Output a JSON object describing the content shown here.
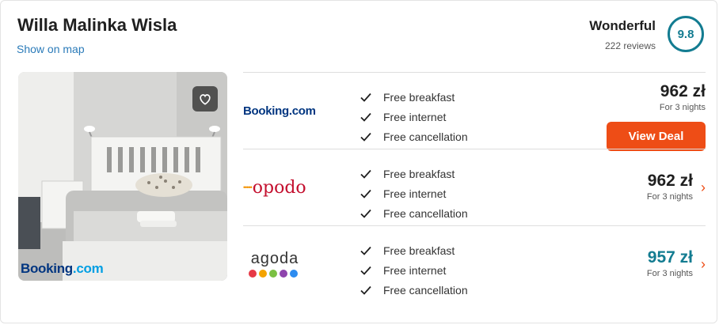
{
  "hotel": {
    "name": "Willa Malinka Wisla",
    "map_link": "Show on map",
    "rating_word": "Wonderful",
    "reviews": "222 reviews",
    "score": "9.8"
  },
  "photo": {
    "logo_booking": "Booking",
    "logo_dotcom": ".com"
  },
  "offers": [
    {
      "provider": "Booking.com",
      "features": [
        "Free breakfast",
        "Free internet",
        "Free cancellation"
      ],
      "price": "962 zł",
      "nights": "For 3 nights",
      "button": "View Deal"
    },
    {
      "provider": "opodo",
      "features": [
        "Free breakfast",
        "Free internet",
        "Free cancellation"
      ],
      "price": "962 zł",
      "nights": "For 3 nights"
    },
    {
      "provider": "agoda",
      "features": [
        "Free breakfast",
        "Free internet",
        "Free cancellation"
      ],
      "price": "957 zł",
      "nights": "For 3 nights"
    }
  ],
  "colors": {
    "accent": "#ee4d16",
    "score_ring": "#137c91",
    "link": "#2b7bb9",
    "best_price": "#137c91",
    "booking_blue": "#003580",
    "booking_light": "#009fe3",
    "opodo_red": "#c4102f"
  },
  "icons": {
    "favorite": "heart-icon",
    "feature": "check-icon",
    "more": "chevron-right-icon"
  }
}
